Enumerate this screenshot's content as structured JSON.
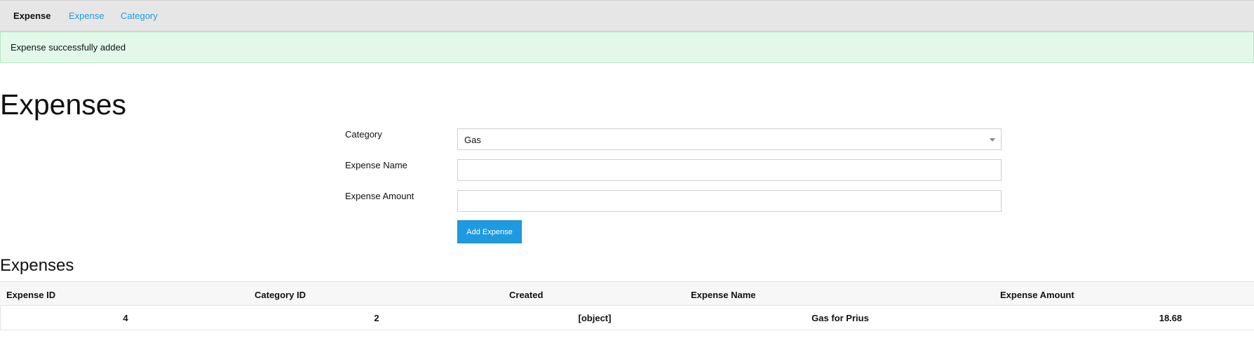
{
  "navbar": {
    "brand": "Expense",
    "links": [
      "Expense",
      "Category"
    ]
  },
  "alert": {
    "message": "Expense successfully added"
  },
  "page": {
    "title": "Expenses"
  },
  "form": {
    "category_label": "Category",
    "category_value": "Gas",
    "expense_name_label": "Expense Name",
    "expense_name_value": "",
    "expense_amount_label": "Expense Amount",
    "expense_amount_value": "",
    "submit_label": "Add Expense"
  },
  "table": {
    "title": "Expenses",
    "columns": [
      "Expense ID",
      "Category ID",
      "Created",
      "Expense Name",
      "Expense Amount"
    ],
    "rows": [
      [
        "4",
        "2",
        "[object]",
        "Gas for Prius",
        "18.68"
      ]
    ]
  },
  "colors": {
    "accent": "#1e9be0",
    "alert_bg": "#e2f9ea",
    "navbar_bg": "#e6e6e6"
  }
}
